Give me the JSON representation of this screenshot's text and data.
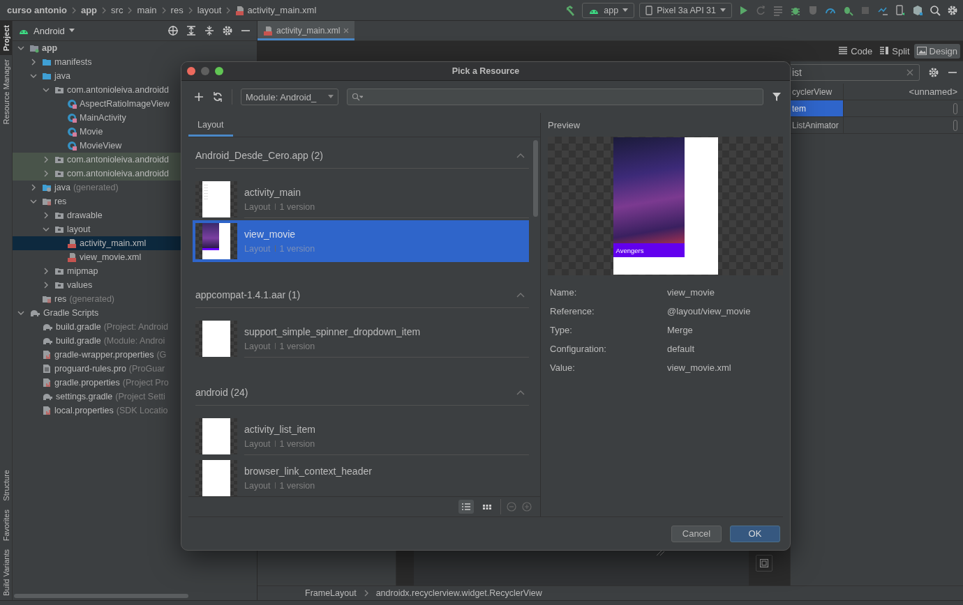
{
  "top_bar": {
    "breadcrumbs": [
      {
        "label": "curso antonio",
        "kind": "project"
      },
      {
        "label": "app",
        "kind": "module"
      },
      {
        "label": "src",
        "kind": "folder"
      },
      {
        "label": "main",
        "kind": "folder"
      },
      {
        "label": "res",
        "kind": "folder"
      },
      {
        "label": "layout",
        "kind": "folder"
      },
      {
        "label": "activity_main.xml",
        "kind": "file"
      }
    ],
    "run_config": "app",
    "device": "Pixel 3a API 31"
  },
  "tool_strip": {
    "top": [
      {
        "label": "Project",
        "selected": true
      },
      {
        "label": "Resource Manager",
        "selected": false
      }
    ],
    "bottom": [
      {
        "label": "Structure",
        "selected": false
      },
      {
        "label": "Favorites",
        "selected": false
      },
      {
        "label": "Build Variants",
        "selected": false
      }
    ]
  },
  "project_panel": {
    "view": "Android",
    "tree": [
      {
        "label": "app",
        "kind": "module",
        "expanded": true,
        "selected": false,
        "children": [
          {
            "label": "manifests",
            "kind": "folder",
            "expanded": false,
            "selected": false
          },
          {
            "label": "java",
            "kind": "folder",
            "expanded": true,
            "selected": false,
            "children": [
              {
                "label": "com.antonioleiva.androidd",
                "kind": "package",
                "expanded": true,
                "selected": false,
                "children": [
                  {
                    "label": "AspectRatioImageView",
                    "kind": "class",
                    "selected": false
                  },
                  {
                    "label": "MainActivity",
                    "kind": "class",
                    "selected": false
                  },
                  {
                    "label": "Movie",
                    "kind": "class",
                    "selected": false
                  },
                  {
                    "label": "MovieView",
                    "kind": "class",
                    "selected": false
                  }
                ]
              },
              {
                "label": "com.antonioleiva.androidd",
                "kind": "test-package",
                "expanded": false,
                "selected": false
              },
              {
                "label": "com.antonioleiva.androidd",
                "kind": "test-package",
                "expanded": false,
                "selected": false
              }
            ]
          },
          {
            "label": "java",
            "note": "(generated)",
            "kind": "generated",
            "expanded": false,
            "selected": false
          },
          {
            "label": "res",
            "kind": "res",
            "expanded": true,
            "selected": false,
            "children": [
              {
                "label": "drawable",
                "kind": "package",
                "expanded": false,
                "selected": false
              },
              {
                "label": "layout",
                "kind": "package",
                "expanded": true,
                "selected": false,
                "children": [
                  {
                    "label": "activity_main.xml",
                    "kind": "layout",
                    "selected": true
                  },
                  {
                    "label": "view_movie.xml",
                    "kind": "layout",
                    "selected": false
                  }
                ]
              },
              {
                "label": "mipmap",
                "kind": "package",
                "expanded": false,
                "selected": false
              },
              {
                "label": "values",
                "kind": "package",
                "expanded": false,
                "selected": false
              }
            ]
          },
          {
            "label": "res",
            "note": "(generated)",
            "kind": "res",
            "selected": false
          }
        ]
      },
      {
        "label": "Gradle Scripts",
        "kind": "gradle",
        "expanded": true,
        "selected": false,
        "children": [
          {
            "label": "build.gradle",
            "note": "(Project: Android",
            "kind": "gradle",
            "selected": false
          },
          {
            "label": "build.gradle",
            "note": "(Module: Androi",
            "kind": "gradle",
            "selected": false
          },
          {
            "label": "gradle-wrapper.properties",
            "note": "(G",
            "kind": "properties",
            "selected": false
          },
          {
            "label": "proguard-rules.pro",
            "note": "(ProGuar",
            "kind": "text",
            "selected": false
          },
          {
            "label": "gradle.properties",
            "note": "(Project Pro",
            "kind": "properties",
            "selected": false
          },
          {
            "label": "settings.gradle",
            "note": "(Project Setti",
            "kind": "gradle",
            "selected": false
          },
          {
            "label": "local.properties",
            "note": "(SDK Locatio",
            "kind": "properties",
            "selected": false
          }
        ]
      }
    ]
  },
  "editor": {
    "tabs": [
      {
        "label": "activity_main.xml",
        "selected": true
      }
    ],
    "view_modes": [
      {
        "label": "Code",
        "kind": "code",
        "selected": false
      },
      {
        "label": "Split",
        "kind": "split",
        "selected": false
      },
      {
        "label": "Design",
        "kind": "design",
        "selected": true
      }
    ],
    "component_tree": {
      "search": "ist",
      "rows": [
        {
          "label": "cyclerView",
          "value": "<unnamed>",
          "selected": false
        },
        {
          "label": "tem",
          "selected": true
        },
        {
          "label": "ListAnimator",
          "selected": false
        }
      ]
    },
    "breadcrumbs": [
      "FrameLayout",
      "androidx.recyclerview.widget.RecyclerView"
    ]
  },
  "dialog": {
    "title": "Pick a Resource",
    "module": "Module: Android_",
    "tabs": [
      {
        "label": "Layout",
        "selected": true
      }
    ],
    "sections": [
      {
        "title": "Android_Desde_Cero.app (2)",
        "expanded": true,
        "items": [
          {
            "name": "activity_main",
            "type": "Layout",
            "versions": "1 version",
            "kind": "text",
            "selected": false
          },
          {
            "name": "view_movie",
            "type": "Layout",
            "versions": "1 version",
            "kind": "poster",
            "selected": true
          }
        ]
      },
      {
        "title": "appcompat-1.4.1.aar (1)",
        "expanded": true,
        "items": [
          {
            "name": "support_simple_spinner_dropdown_item",
            "type": "Layout",
            "versions": "1 version",
            "kind": "blank",
            "selected": false
          }
        ]
      },
      {
        "title": "android (24)",
        "expanded": true,
        "items": [
          {
            "name": "activity_list_item",
            "type": "Layout",
            "versions": "1 version",
            "kind": "blank",
            "selected": false
          },
          {
            "name": "browser_link_context_header",
            "type": "Layout",
            "versions": "1 version",
            "kind": "blank",
            "selected": false
          }
        ]
      }
    ],
    "view_toggle": [
      {
        "kind": "list",
        "selected": true
      },
      {
        "kind": "grid",
        "selected": false
      }
    ],
    "preview": {
      "label": "Preview",
      "caption": "Avengers",
      "details": [
        {
          "label": "Name:",
          "value": "view_movie"
        },
        {
          "label": "Reference:",
          "value": "@layout/view_movie"
        },
        {
          "label": "Type:",
          "value": "Merge"
        },
        {
          "label": "Configuration:",
          "value": "default"
        },
        {
          "label": "Value:",
          "value": "view_movie.xml"
        }
      ]
    },
    "buttons": [
      {
        "label": "Cancel",
        "kind": "secondary"
      },
      {
        "label": "OK",
        "kind": "primary"
      }
    ]
  }
}
